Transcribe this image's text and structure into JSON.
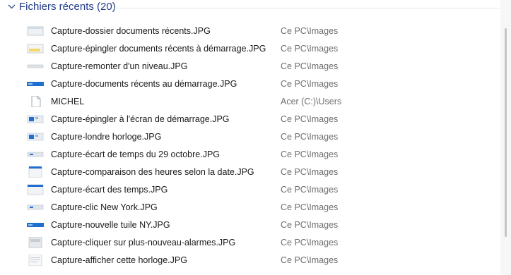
{
  "group": {
    "title": "Fichiers récents (20)",
    "chevron_icon": "chevron-down-icon"
  },
  "files": [
    {
      "name": "Capture-dossier documents récents.JPG",
      "folder": "Ce PC\\Images",
      "icon": "image-thumbnail-icon",
      "thumb": "window-light"
    },
    {
      "name": "Capture-épingler documents récents à démarrage.JPG",
      "folder": "Ce PC\\Images",
      "icon": "image-thumbnail-icon",
      "thumb": "window-yellow"
    },
    {
      "name": "Capture-remonter d'un niveau.JPG",
      "folder": "Ce PC\\Images",
      "icon": "image-thumbnail-icon",
      "thumb": "strip"
    },
    {
      "name": "Capture-documents récents au démarrage.JPG",
      "folder": "Ce PC\\Images",
      "icon": "image-thumbnail-icon",
      "thumb": "blue-strip"
    },
    {
      "name": "MICHEL",
      "folder": "Acer (C:)\\Users",
      "icon": "document-icon",
      "thumb": "document"
    },
    {
      "name": "Capture-épingler à l'écran de démarrage.JPG",
      "folder": "Ce PC\\Images",
      "icon": "image-thumbnail-icon",
      "thumb": "tiles"
    },
    {
      "name": "Capture-londre horloge.JPG",
      "folder": "Ce PC\\Images",
      "icon": "image-thumbnail-icon",
      "thumb": "tiles"
    },
    {
      "name": "Capture-écart de temps du 29 octobre.JPG",
      "folder": "Ce PC\\Images",
      "icon": "image-thumbnail-icon",
      "thumb": "strip-blue-dot"
    },
    {
      "name": "Capture-comparaison des heures selon la date.JPG",
      "folder": "Ce PC\\Images",
      "icon": "image-thumbnail-icon",
      "thumb": "page-blue"
    },
    {
      "name": "Capture-écart des temps.JPG",
      "folder": "Ce PC\\Images",
      "icon": "image-thumbnail-icon",
      "thumb": "window-blue"
    },
    {
      "name": "Capture-clic New York.JPG",
      "folder": "Ce PC\\Images",
      "icon": "image-thumbnail-icon",
      "thumb": "strip-blue-dot"
    },
    {
      "name": "Capture-nouvelle tuile NY.JPG",
      "folder": "Ce PC\\Images",
      "icon": "image-thumbnail-icon",
      "thumb": "blue-strip"
    },
    {
      "name": "Capture-cliquer sur plus-nouveau-alarmes.JPG",
      "folder": "Ce PC\\Images",
      "icon": "image-thumbnail-icon",
      "thumb": "page-gray"
    },
    {
      "name": "Capture-afficher cette horloge.JPG",
      "folder": "Ce PC\\Images",
      "icon": "image-thumbnail-icon",
      "thumb": "page-lines"
    }
  ],
  "colors": {
    "group_title": "#1e3a8a",
    "thumb_blue": "#1f6fd1",
    "folder_text": "#6e6e6e"
  }
}
